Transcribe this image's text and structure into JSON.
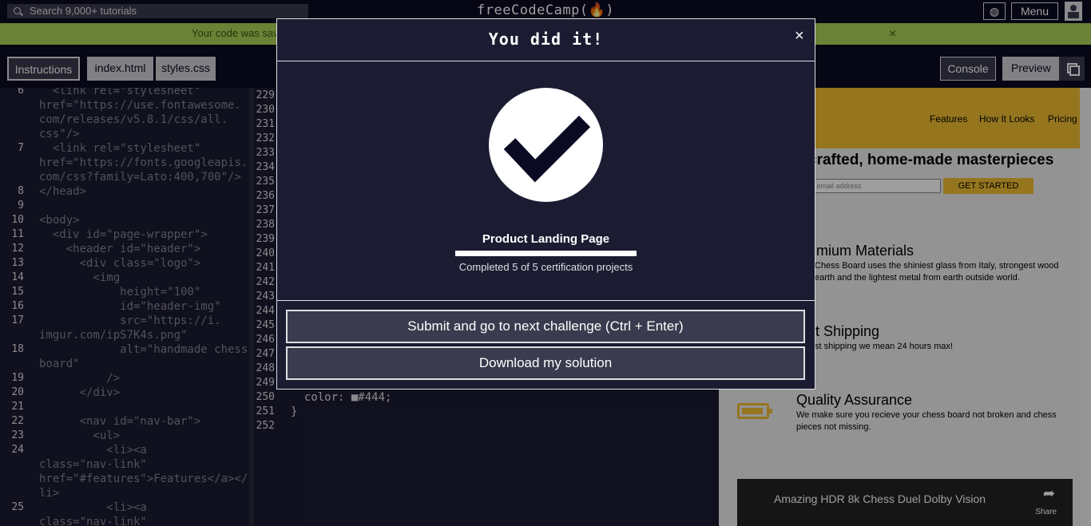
{
  "nav": {
    "search_placeholder": "Search 9,000+ tutorials",
    "logo": "freeCodeCamp(🔥)",
    "menu": "Menu"
  },
  "flash": {
    "text": "Your code was sav",
    "close": "×"
  },
  "tabs": {
    "instructions": "Instructions",
    "index": "index.html",
    "styles": "styles.css",
    "console": "Console",
    "preview": "Preview"
  },
  "editor_html": {
    "lines": [
      {
        "n": "6",
        "text": "  <link rel=\"stylesheet\""
      },
      {
        "n": "",
        "text": "href=\"https://use.fontawesome."
      },
      {
        "n": "",
        "text": "com/releases/v5.8.1/css/all."
      },
      {
        "n": "",
        "text": "css\"/>"
      },
      {
        "n": "7",
        "text": "  <link rel=\"stylesheet\""
      },
      {
        "n": "",
        "text": "href=\"https://fonts.googleapis."
      },
      {
        "n": "",
        "text": "com/css?family=Lato:400,700\"/>"
      },
      {
        "n": "8",
        "text": "</head>"
      },
      {
        "n": "9",
        "text": ""
      },
      {
        "n": "10",
        "text": "<body>"
      },
      {
        "n": "11",
        "text": "  <div id=\"page-wrapper\">"
      },
      {
        "n": "12",
        "text": "    <header id=\"header\">"
      },
      {
        "n": "13",
        "text": "      <div class=\"logo\">"
      },
      {
        "n": "14",
        "text": "        <img"
      },
      {
        "n": "15",
        "text": "            height=\"100\""
      },
      {
        "n": "16",
        "text": "            id=\"header-img\""
      },
      {
        "n": "17",
        "text": "            src=\"https://i."
      },
      {
        "n": "",
        "text": "imgur.com/ipS7K4s.png\""
      },
      {
        "n": "18",
        "text": "            alt=\"handmade chess"
      },
      {
        "n": "",
        "text": "board\""
      },
      {
        "n": "19",
        "text": "          />"
      },
      {
        "n": "20",
        "text": "      </div>"
      },
      {
        "n": "21",
        "text": ""
      },
      {
        "n": "22",
        "text": "      <nav id=\"nav-bar\">"
      },
      {
        "n": "23",
        "text": "        <ul>"
      },
      {
        "n": "24",
        "text": "          <li><a"
      },
      {
        "n": "",
        "text": "class=\"nav-link\""
      },
      {
        "n": "",
        "text": "href=\"#features\">Features</a></"
      },
      {
        "n": "",
        "text": "li>"
      },
      {
        "n": "25",
        "text": "          <li><a"
      },
      {
        "n": "",
        "text": "class=\"nav-link\""
      }
    ]
  },
  "editor_css": {
    "line_numbers": [
      "229",
      "230",
      "231",
      "232",
      "233",
      "234",
      "235",
      "236",
      "237",
      "238",
      "239",
      "240",
      "241",
      "242",
      "243",
      "244",
      "245",
      "246",
      "247",
      "248",
      "249",
      "250",
      "251",
      "252"
    ],
    "visible_code": [
      {
        "n": "250",
        "text": "  color: ■#444;"
      },
      {
        "n": "251",
        "text": "}"
      },
      {
        "n": "252",
        "text": ""
      }
    ]
  },
  "preview": {
    "nav": [
      "Features",
      "How It Looks",
      "Pricing"
    ],
    "hero_title": "crafted, home-made masterpieces",
    "email_placeholder": "r email address",
    "get_started": "GET STARTED",
    "features": [
      {
        "title": "emium Materials",
        "text1": "Chess Board uses the shiniest glass from Italy, strongest wood",
        "text2": "earth and the lightest metal from earth outside world."
      },
      {
        "title": "st Shipping",
        "text1": "st shipping we mean 24 hours max!",
        "text2": ""
      },
      {
        "title": "Quality Assurance",
        "text1": "We make sure you recieve your chess board not broken and chess",
        "text2": "pieces not missing."
      }
    ],
    "video_title": "Amazing HDR 8k Chess Duel Dolby Vision",
    "video_share": "Share"
  },
  "modal": {
    "title": "You did it!",
    "close": "×",
    "project": "Product Landing Page",
    "progress_fraction": 1.0,
    "progress_text": "Completed 5 of 5 certification projects",
    "submit_button": "Submit and go to next challenge (Ctrl + Enter)",
    "download_button": "Download my solution"
  },
  "colors": {
    "bg": "#0a0a23",
    "panel": "#1b1b32",
    "button": "#3b3b4f",
    "accent_yellow": "#f1be32",
    "flash_green": "#acd157"
  }
}
